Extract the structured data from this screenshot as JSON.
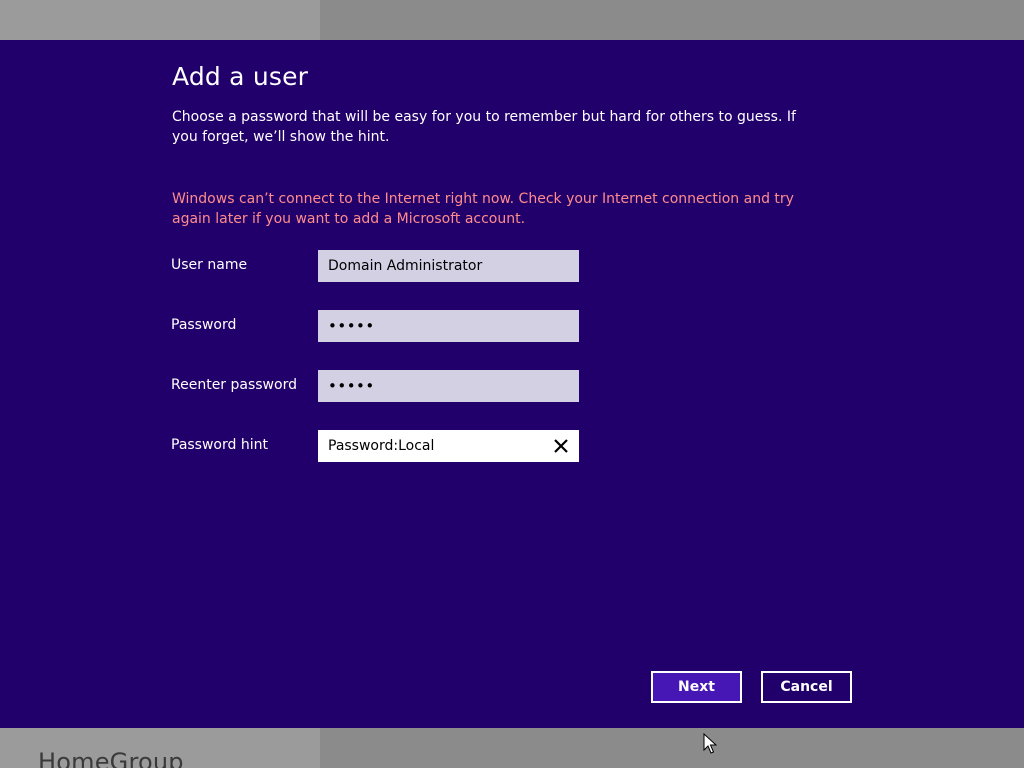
{
  "dialog": {
    "title": "Add a user",
    "description": "Choose a password that will be easy for you to remember but hard for others to guess. If you forget, we’ll show the hint.",
    "warning": "Windows can’t connect to the Internet right now. Check your Internet connection and try again later if you want to add a Microsoft account.",
    "fields": {
      "username": {
        "label": "User name",
        "value": "Domain Administrator"
      },
      "password": {
        "label": "Password",
        "value": "•••••"
      },
      "reenter": {
        "label": "Reenter password",
        "value": "•••••"
      },
      "hint": {
        "label": "Password hint",
        "value": "Password:Local"
      }
    },
    "buttons": {
      "next": "Next",
      "cancel": "Cancel"
    }
  },
  "background": {
    "peek_text": "HomeGroup"
  },
  "colors": {
    "dialog_bg": "#22006b",
    "warning_text": "#ff8c8c",
    "input_bg": "#d4d0e4",
    "next_button_bg": "#4617b4"
  },
  "icons": {
    "clear": "close-icon",
    "pointer": "cursor-icon"
  }
}
